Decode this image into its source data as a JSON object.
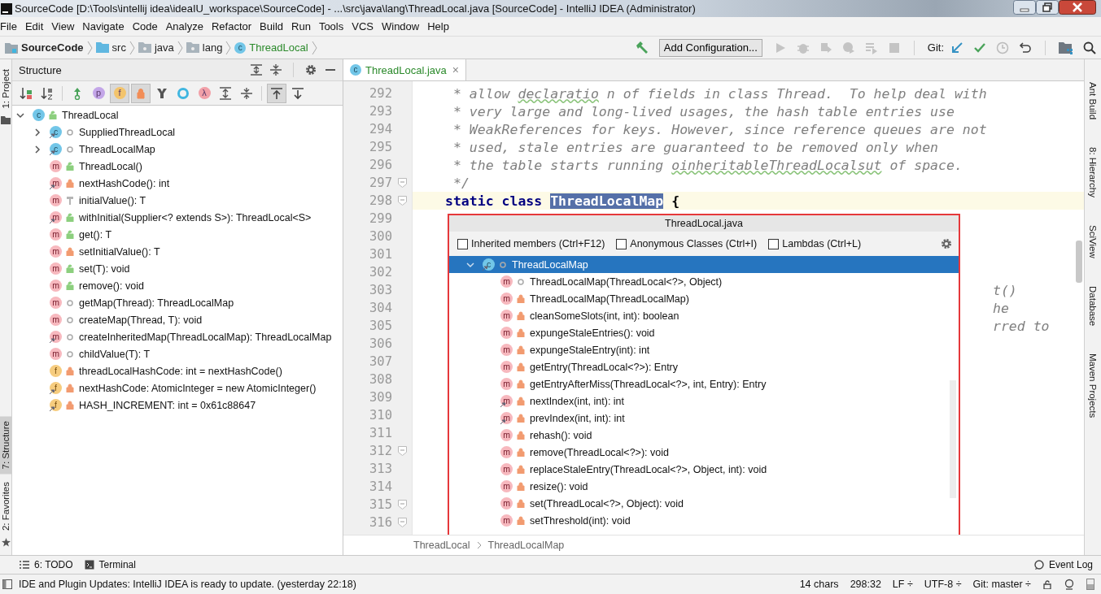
{
  "window": {
    "title": "SourceCode [D:\\Tools\\intellij idea\\ideaIU_workspace\\SourceCode] - ...\\src\\java\\lang\\ThreadLocal.java [SourceCode] - IntelliJ IDEA (Administrator)"
  },
  "menu": [
    "File",
    "Edit",
    "View",
    "Navigate",
    "Code",
    "Analyze",
    "Refactor",
    "Build",
    "Run",
    "Tools",
    "VCS",
    "Window",
    "Help"
  ],
  "breadcrumbs": [
    {
      "label": "SourceCode",
      "kind": "project"
    },
    {
      "label": "src",
      "kind": "source-folder"
    },
    {
      "label": "java",
      "kind": "folder"
    },
    {
      "label": "lang",
      "kind": "folder"
    },
    {
      "label": "ThreadLocal",
      "kind": "class",
      "badge": "c"
    }
  ],
  "run_config": "Add Configuration...",
  "run_tools": [
    {
      "kind": "run",
      "disabled": true
    },
    {
      "kind": "debug",
      "disabled": true
    },
    {
      "kind": "coverage",
      "disabled": true
    },
    {
      "kind": "profile",
      "disabled": true
    },
    {
      "kind": "run-list",
      "disabled": true
    },
    {
      "kind": "stop",
      "disabled": true
    }
  ],
  "git_label": "Git:",
  "left_tabs": [
    {
      "label": "1: Project",
      "selected": false
    },
    {
      "label": "7: Structure",
      "selected": true
    },
    {
      "label": "2: Favorites",
      "selected": false
    }
  ],
  "right_tabs": [
    "Ant Build",
    "8: Hierarchy",
    "SciView",
    "Database",
    "Maven Projects"
  ],
  "structure": {
    "title": "Structure",
    "toolbar": [
      {
        "kind": "sort-visibility",
        "pressed": false
      },
      {
        "kind": "sort-alpha",
        "pressed": false
      },
      {
        "kind": "inherited",
        "pressed": false
      },
      {
        "kind": "letter",
        "glyph": "p",
        "color": "#c3a6e8",
        "pressed": false
      },
      {
        "kind": "letter",
        "glyph": "f",
        "color": "#f3c46c",
        "pressed": true
      },
      {
        "kind": "lock",
        "pressed": true
      },
      {
        "kind": "funnel",
        "pressed": false
      },
      {
        "kind": "ring",
        "pressed": false
      },
      {
        "kind": "letter",
        "glyph": "λ",
        "color": "#f2a0a8",
        "pressed": false
      },
      {
        "kind": "expand",
        "pressed": false
      },
      {
        "kind": "collapse",
        "pressed": false
      },
      {
        "kind": "scroll-to",
        "pressed": true
      },
      {
        "kind": "scroll-from",
        "pressed": false
      }
    ],
    "tree": [
      {
        "label": "ThreadLocal",
        "kind": "class",
        "badge": "c",
        "access": {
          "kind": "public"
        },
        "static": false,
        "expanded": true,
        "children": [
          {
            "label": "SuppliedThreadLocal",
            "kind": "class",
            "badge": "c",
            "access": {
              "kind": "package"
            },
            "static": true,
            "expanded": false
          },
          {
            "label": "ThreadLocalMap",
            "kind": "class",
            "badge": "c",
            "access": {
              "kind": "package"
            },
            "static": true,
            "expanded": false
          },
          {
            "label": "ThreadLocal()",
            "kind": "method",
            "badge": "m",
            "access": {
              "kind": "public"
            },
            "static": false
          },
          {
            "label": "nextHashCode(): int",
            "kind": "method",
            "badge": "m",
            "access": {
              "kind": "private"
            },
            "static": true
          },
          {
            "label": "initialValue(): T",
            "kind": "method",
            "badge": "m",
            "access": {
              "kind": "protected"
            },
            "static": false
          },
          {
            "label": "withInitial(Supplier<? extends S>): ThreadLocal<S>",
            "kind": "method",
            "badge": "m",
            "access": {
              "kind": "public"
            },
            "static": true
          },
          {
            "label": "get(): T",
            "kind": "method",
            "badge": "m",
            "access": {
              "kind": "public"
            },
            "static": false
          },
          {
            "label": "setInitialValue(): T",
            "kind": "method",
            "badge": "m",
            "access": {
              "kind": "private"
            },
            "static": false
          },
          {
            "label": "set(T): void",
            "kind": "method",
            "badge": "m",
            "access": {
              "kind": "public"
            },
            "static": false
          },
          {
            "label": "remove(): void",
            "kind": "method",
            "badge": "m",
            "access": {
              "kind": "public"
            },
            "static": false
          },
          {
            "label": "getMap(Thread): ThreadLocalMap",
            "kind": "method",
            "badge": "m",
            "access": {
              "kind": "package"
            },
            "static": false
          },
          {
            "label": "createMap(Thread, T): void",
            "kind": "method",
            "badge": "m",
            "access": {
              "kind": "package"
            },
            "static": false
          },
          {
            "label": "createInheritedMap(ThreadLocalMap): ThreadLocalMap",
            "kind": "method",
            "badge": "m",
            "access": {
              "kind": "package"
            },
            "static": true
          },
          {
            "label": "childValue(T): T",
            "kind": "method",
            "badge": "m",
            "access": {
              "kind": "package"
            },
            "static": false
          },
          {
            "label": "threadLocalHashCode: int = nextHashCode()",
            "kind": "field",
            "badge": "f",
            "access": {
              "kind": "private"
            },
            "static": false
          },
          {
            "label": "nextHashCode: AtomicInteger = new AtomicInteger()",
            "kind": "field",
            "badge": "f",
            "access": {
              "kind": "private"
            },
            "static": true
          },
          {
            "label": "HASH_INCREMENT: int = 0x61c88647",
            "kind": "field",
            "badge": "f",
            "access": {
              "kind": "private"
            },
            "static": true
          }
        ]
      }
    ]
  },
  "editor": {
    "tab": {
      "label": "ThreadLocal.java",
      "badge": "c",
      "close": "×",
      "selected": true
    },
    "lines": [
      {
        "number": "292",
        "kind": "comment",
        "segments": [
          {
            "text": "* allow ",
            "kind": "comment"
          },
          {
            "text": "declaratio",
            "kind": "typo"
          },
          {
            "text": " n of fields in class Thread.  To help deal with",
            "kind": "comment"
          }
        ]
      },
      {
        "number": "293",
        "kind": "comment",
        "segments": [
          {
            "text": "* very large and long-lived usages, the hash table entries use",
            "kind": "comment"
          }
        ]
      },
      {
        "number": "294",
        "kind": "comment",
        "segments": [
          {
            "text": "* WeakReferences for keys. However, since reference queues are not",
            "kind": "comment"
          }
        ]
      },
      {
        "number": "295",
        "kind": "comment",
        "segments": [
          {
            "text": "* used, stale entries are guaranteed to be removed only when",
            "kind": "comment"
          }
        ]
      },
      {
        "number": "296",
        "kind": "comment",
        "segments": [
          {
            "text": "* the table starts running ",
            "kind": "comment"
          },
          {
            "text": "oinheritableThreadLocalsut",
            "kind": "typo"
          },
          {
            "text": " of space.",
            "kind": "comment"
          }
        ]
      },
      {
        "number": "297",
        "kind": "comment",
        "fold": true,
        "segments": [
          {
            "text": "*/",
            "kind": "comment"
          }
        ]
      },
      {
        "number": "298",
        "kind": "code",
        "fold": true,
        "current": true,
        "segments": [
          {
            "text": "static class ",
            "kind": "keyword"
          },
          {
            "text": "ThreadLocalMap",
            "kind": "selection"
          },
          {
            "text": " {",
            "kind": "plain"
          }
        ]
      },
      {
        "number": "299",
        "kind": "code"
      },
      {
        "number": "300",
        "kind": "code"
      },
      {
        "number": "301",
        "kind": "code"
      },
      {
        "number": "302",
        "kind": "code"
      },
      {
        "number": "303",
        "kind": "code",
        "tail": "t()"
      },
      {
        "number": "304",
        "kind": "code",
        "tail": "he"
      },
      {
        "number": "305",
        "kind": "code",
        "tail": "rred to"
      },
      {
        "number": "306",
        "kind": "code"
      },
      {
        "number": "307",
        "kind": "code"
      },
      {
        "number": "308",
        "kind": "code"
      },
      {
        "number": "309",
        "kind": "code"
      },
      {
        "number": "310",
        "kind": "code"
      },
      {
        "number": "311",
        "kind": "code"
      },
      {
        "number": "312",
        "kind": "code",
        "fold": true
      },
      {
        "number": "313",
        "kind": "code"
      },
      {
        "number": "314",
        "kind": "code"
      },
      {
        "number": "315",
        "kind": "code",
        "fold": true
      },
      {
        "number": "316",
        "kind": "code",
        "fold": true
      }
    ],
    "breadcrumb": [
      "ThreadLocal",
      "ThreadLocalMap"
    ]
  },
  "popup": {
    "title": "ThreadLocal.java",
    "options": [
      {
        "label": "Inherited members (Ctrl+F12)",
        "checked": false
      },
      {
        "label": "Anonymous Classes (Ctrl+I)",
        "checked": false
      },
      {
        "label": "Lambdas (Ctrl+L)",
        "checked": false
      }
    ],
    "tree": [
      {
        "label": "ThreadLocalMap",
        "kind": "class",
        "badge": "c",
        "access": {
          "kind": "package"
        },
        "static": true,
        "expanded": true,
        "selected": true,
        "children": [
          {
            "label": "ThreadLocalMap(ThreadLocal<?>, Object)",
            "kind": "method",
            "badge": "m",
            "access": {
              "kind": "package"
            },
            "static": false,
            "selected": false
          },
          {
            "label": "ThreadLocalMap(ThreadLocalMap)",
            "kind": "method",
            "badge": "m",
            "access": {
              "kind": "private"
            },
            "static": false,
            "selected": false
          },
          {
            "label": "cleanSomeSlots(int, int): boolean",
            "kind": "method",
            "badge": "m",
            "access": {
              "kind": "private"
            },
            "static": false,
            "selected": false
          },
          {
            "label": "expungeStaleEntries(): void",
            "kind": "method",
            "badge": "m",
            "access": {
              "kind": "private"
            },
            "static": false,
            "selected": false
          },
          {
            "label": "expungeStaleEntry(int): int",
            "kind": "method",
            "badge": "m",
            "access": {
              "kind": "private"
            },
            "static": false,
            "selected": false
          },
          {
            "label": "getEntry(ThreadLocal<?>): Entry",
            "kind": "method",
            "badge": "m",
            "access": {
              "kind": "private"
            },
            "static": false,
            "selected": false
          },
          {
            "label": "getEntryAfterMiss(ThreadLocal<?>, int, Entry): Entry",
            "kind": "method",
            "badge": "m",
            "access": {
              "kind": "private"
            },
            "static": false,
            "selected": false
          },
          {
            "label": "nextIndex(int, int): int",
            "kind": "method",
            "badge": "m",
            "access": {
              "kind": "private"
            },
            "static": true,
            "selected": false
          },
          {
            "label": "prevIndex(int, int): int",
            "kind": "method",
            "badge": "m",
            "access": {
              "kind": "private"
            },
            "static": true,
            "selected": false
          },
          {
            "label": "rehash(): void",
            "kind": "method",
            "badge": "m",
            "access": {
              "kind": "private"
            },
            "static": false,
            "selected": false
          },
          {
            "label": "remove(ThreadLocal<?>): void",
            "kind": "method",
            "badge": "m",
            "access": {
              "kind": "private"
            },
            "static": false,
            "selected": false
          },
          {
            "label": "replaceStaleEntry(ThreadLocal<?>, Object, int): void",
            "kind": "method",
            "badge": "m",
            "access": {
              "kind": "private"
            },
            "static": false,
            "selected": false
          },
          {
            "label": "resize(): void",
            "kind": "method",
            "badge": "m",
            "access": {
              "kind": "private"
            },
            "static": false,
            "selected": false
          },
          {
            "label": "set(ThreadLocal<?>, Object): void",
            "kind": "method",
            "badge": "m",
            "access": {
              "kind": "private"
            },
            "static": false,
            "selected": false
          },
          {
            "label": "setThreshold(int): void",
            "kind": "method",
            "badge": "m",
            "access": {
              "kind": "private"
            },
            "static": false,
            "selected": false
          }
        ]
      }
    ]
  },
  "bottom_tabs": [
    {
      "label": "6: TODO",
      "kind": "todo"
    },
    {
      "label": "Terminal",
      "kind": "terminal"
    }
  ],
  "event_log": "Event Log",
  "status": {
    "message": "IDE and Plugin Updates: IntelliJ IDEA is ready to update. (yesterday 22:18)",
    "items": [
      "14 chars",
      "298:32",
      "LF ÷",
      "UTF-8 ÷",
      "Git: master ÷"
    ]
  }
}
